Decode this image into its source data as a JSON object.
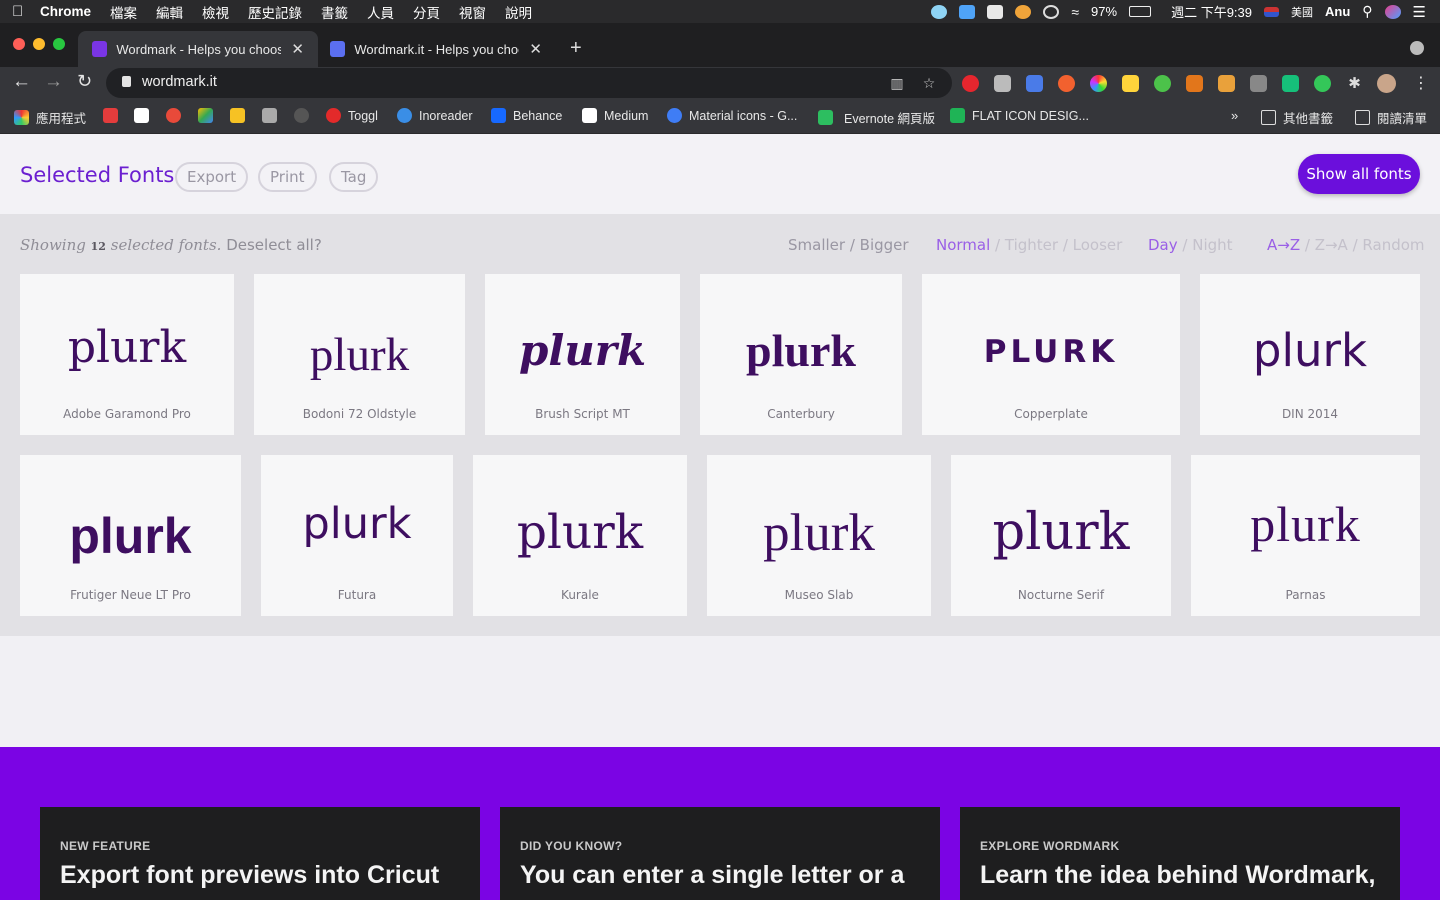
{
  "menubar": {
    "app": "Chrome",
    "items": [
      "檔案",
      "編輯",
      "檢視",
      "歷史記錄",
      "書籤",
      "人員",
      "分頁",
      "視窗",
      "說明"
    ],
    "battery": "97%",
    "clock": "週二 下午9:39",
    "input_source": "美國",
    "user": "Anu"
  },
  "tabs": [
    {
      "title": "Wordmark - Helps you choose"
    },
    {
      "title": "Wordmark.it - Helps you choos"
    }
  ],
  "toolbar": {
    "url": "wordmark.it"
  },
  "bookmarks": [
    {
      "label": "應用程式"
    },
    {
      "label": "Toggl"
    },
    {
      "label": "Inoreader"
    },
    {
      "label": "Behance"
    },
    {
      "label": "Medium"
    },
    {
      "label": "Material icons - G..."
    },
    {
      "label": "Evernote 網頁版"
    },
    {
      "label": "FLAT ICON DESIG..."
    },
    {
      "label": "其他書籤"
    },
    {
      "label": "閱讀清單"
    }
  ],
  "page": {
    "title": "Selected Fonts",
    "pills": [
      "Export",
      "Print",
      "Tag"
    ],
    "show_all": "Show all fonts",
    "status": {
      "prefix": "Showing",
      "count": "12",
      "suffix": "selected fonts.",
      "deselect": "Deselect all?"
    },
    "size_ctl": {
      "a": "Smaller",
      "sep": " / ",
      "b": "Bigger"
    },
    "spacing_ctl": {
      "a": "Normal",
      "b": "Tighter",
      "c": "Looser",
      "sep": " / "
    },
    "theme_ctl": {
      "a": "Day",
      "b": "Night",
      "sep": " / "
    },
    "sort_ctl": {
      "a": "A→Z",
      "b": "Z→A",
      "c": "Random",
      "sep": " / "
    },
    "sample_text": "plurk",
    "fonts": [
      {
        "name": "Adobe Garamond Pro"
      },
      {
        "name": "Bodoni 72 Oldstyle"
      },
      {
        "name": "Brush Script MT"
      },
      {
        "name": "Canterbury"
      },
      {
        "name": "Copperplate"
      },
      {
        "name": "DIN 2014"
      },
      {
        "name": "Frutiger Neue LT Pro"
      },
      {
        "name": "Futura"
      },
      {
        "name": "Kurale"
      },
      {
        "name": "Museo Slab"
      },
      {
        "name": "Nocturne Serif"
      },
      {
        "name": "Parnas"
      }
    ]
  },
  "promos": [
    {
      "kicker": "NEW FEATURE",
      "head": "Export font previews into Cricut"
    },
    {
      "kicker": "DID YOU KNOW?",
      "head": "You can enter a single letter or a"
    },
    {
      "kicker": "EXPLORE WORDMARK",
      "head": "Learn the idea behind Wordmark,"
    }
  ],
  "colors": {
    "accent": "#6b0fdc",
    "sample": "#3e0e60",
    "footer": "#7b04e4"
  }
}
